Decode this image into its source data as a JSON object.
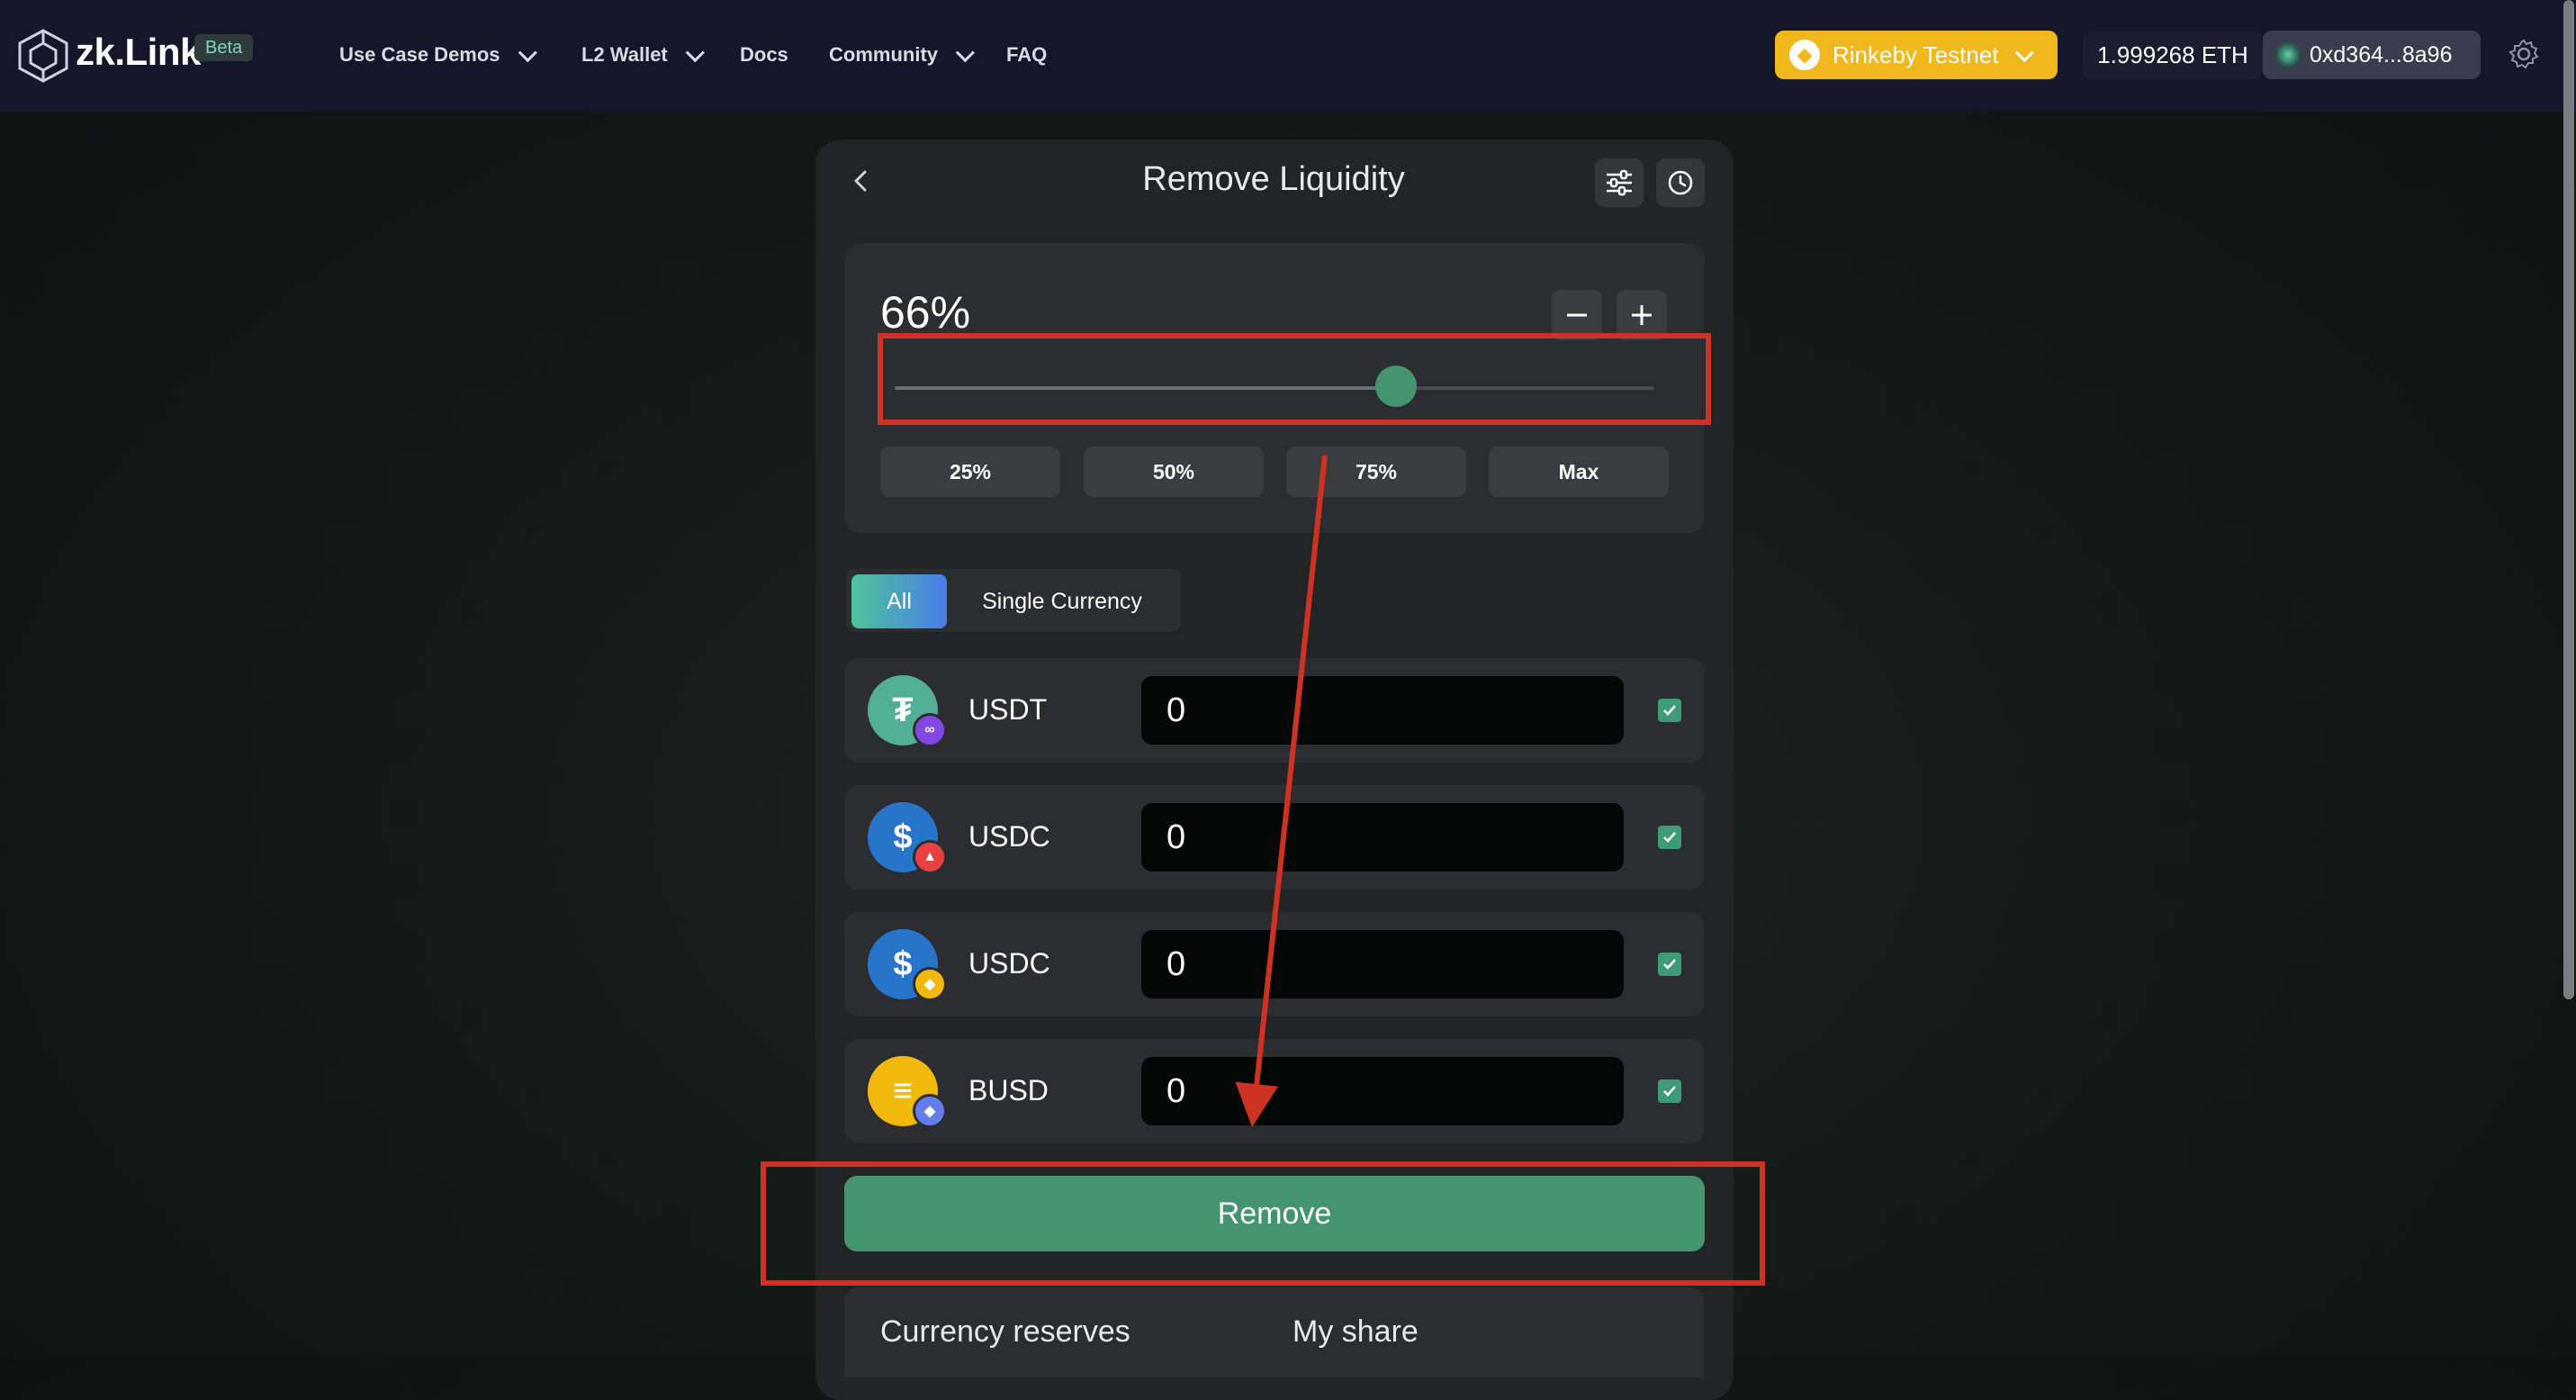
{
  "navbar": {
    "logo_text": "zk.Link",
    "beta_badge": "Beta",
    "items": [
      {
        "label": "Use Case Demos",
        "has_dropdown": true
      },
      {
        "label": "L2 Wallet",
        "has_dropdown": true
      },
      {
        "label": "Docs",
        "has_dropdown": false
      },
      {
        "label": "Community",
        "has_dropdown": true
      },
      {
        "label": "FAQ",
        "has_dropdown": false
      }
    ],
    "network": "Rinkeby Testnet",
    "balance": "1.999268 ETH",
    "address": "0xd364...8a96",
    "settings_icon": "gear-icon"
  },
  "panel": {
    "title": "Remove Liquidity",
    "slider": {
      "percent_label": "66%",
      "value": 0.66,
      "presets": [
        "25%",
        "50%",
        "75%",
        "Max"
      ]
    },
    "mode_tabs": {
      "all": "All",
      "single": "Single Currency",
      "selected": "All"
    },
    "tokens": [
      {
        "symbol": "USDT",
        "amount": "0",
        "checked": true,
        "color": "#50af95",
        "chain_badge_color": "#8247e5",
        "chain": "polygon"
      },
      {
        "symbol": "USDC",
        "amount": "0",
        "checked": true,
        "color": "#2775ca",
        "chain_badge_color": "#e84142",
        "chain": "avalanche"
      },
      {
        "symbol": "USDC",
        "amount": "0",
        "checked": true,
        "color": "#2775ca",
        "chain_badge_color": "#f0b90b",
        "chain": "bsc"
      },
      {
        "symbol": "BUSD",
        "amount": "0",
        "checked": true,
        "color": "#f0b90b",
        "chain_badge_color": "#627eea",
        "chain": "ethereum"
      }
    ],
    "remove_label": "Remove",
    "reserves_label": "Currency reserves",
    "share_label": "My share"
  },
  "colors": {
    "accent_green": "#449470",
    "network_yellow": "#f0b81d",
    "annotation_red": "#cc3322"
  }
}
